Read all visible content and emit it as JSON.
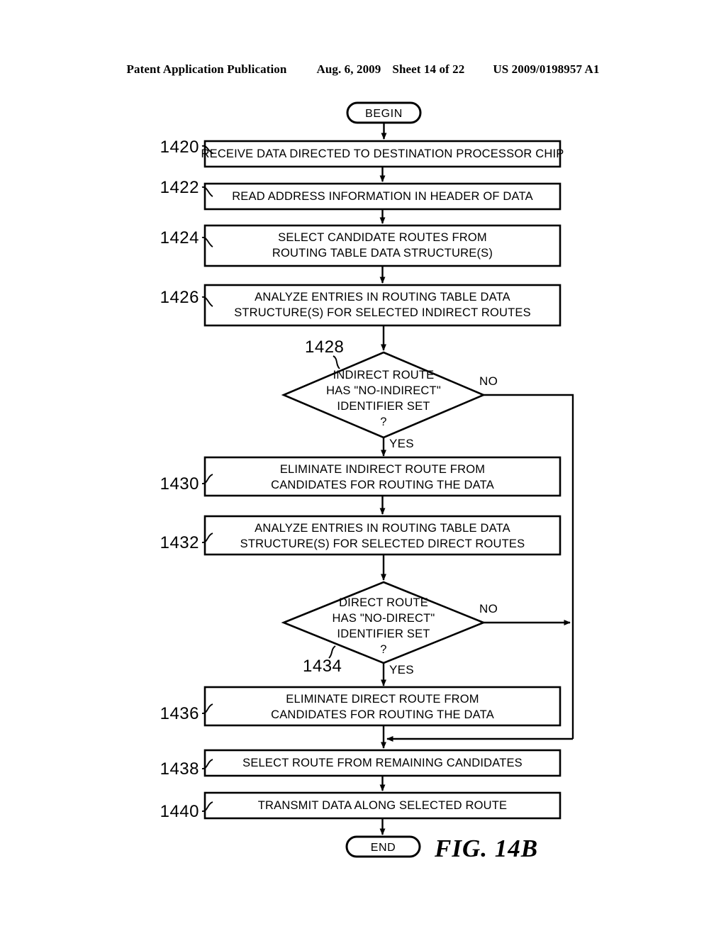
{
  "header": {
    "publication": "Patent Application Publication",
    "date": "Aug. 6, 2009",
    "sheet": "Sheet 14 of 22",
    "doc_number": "US 2009/0198957 A1"
  },
  "figure": {
    "label": "FIG. 14B",
    "start_terminal": "BEGIN",
    "end_terminal": "END",
    "steps": [
      {
        "ref": "1420",
        "lines": [
          "RECEIVE DATA DIRECTED TO DESTINATION PROCESSOR CHIP"
        ]
      },
      {
        "ref": "1422",
        "lines": [
          "READ ADDRESS INFORMATION IN HEADER OF DATA"
        ]
      },
      {
        "ref": "1424",
        "lines": [
          "SELECT CANDIDATE ROUTES FROM",
          "ROUTING TABLE DATA STRUCTURE(S)"
        ]
      },
      {
        "ref": "1426",
        "lines": [
          "ANALYZE ENTRIES IN ROUTING TABLE DATA",
          "STRUCTURE(S) FOR SELECTED INDIRECT ROUTES"
        ]
      },
      {
        "ref": "1430",
        "lines": [
          "ELIMINATE INDIRECT ROUTE FROM",
          "CANDIDATES FOR ROUTING THE DATA"
        ]
      },
      {
        "ref": "1432",
        "lines": [
          "ANALYZE ENTRIES IN ROUTING TABLE DATA",
          "STRUCTURE(S) FOR SELECTED DIRECT ROUTES"
        ]
      },
      {
        "ref": "1436",
        "lines": [
          "ELIMINATE DIRECT ROUTE FROM",
          "CANDIDATES FOR ROUTING THE DATA"
        ]
      },
      {
        "ref": "1438",
        "lines": [
          "SELECT ROUTE FROM REMAINING CANDIDATES"
        ]
      },
      {
        "ref": "1440",
        "lines": [
          "TRANSMIT DATA ALONG SELECTED ROUTE"
        ]
      }
    ],
    "decisions": [
      {
        "ref": "1428",
        "lines": [
          "INDIRECT ROUTE",
          "HAS \"NO-INDIRECT\"",
          "IDENTIFIER SET",
          "?"
        ],
        "yes_label": "YES",
        "no_label": "NO"
      },
      {
        "ref": "1434",
        "lines": [
          "DIRECT ROUTE",
          "HAS \"NO-DIRECT\"",
          "IDENTIFIER SET",
          "?"
        ],
        "yes_label": "YES",
        "no_label": "NO"
      }
    ]
  }
}
